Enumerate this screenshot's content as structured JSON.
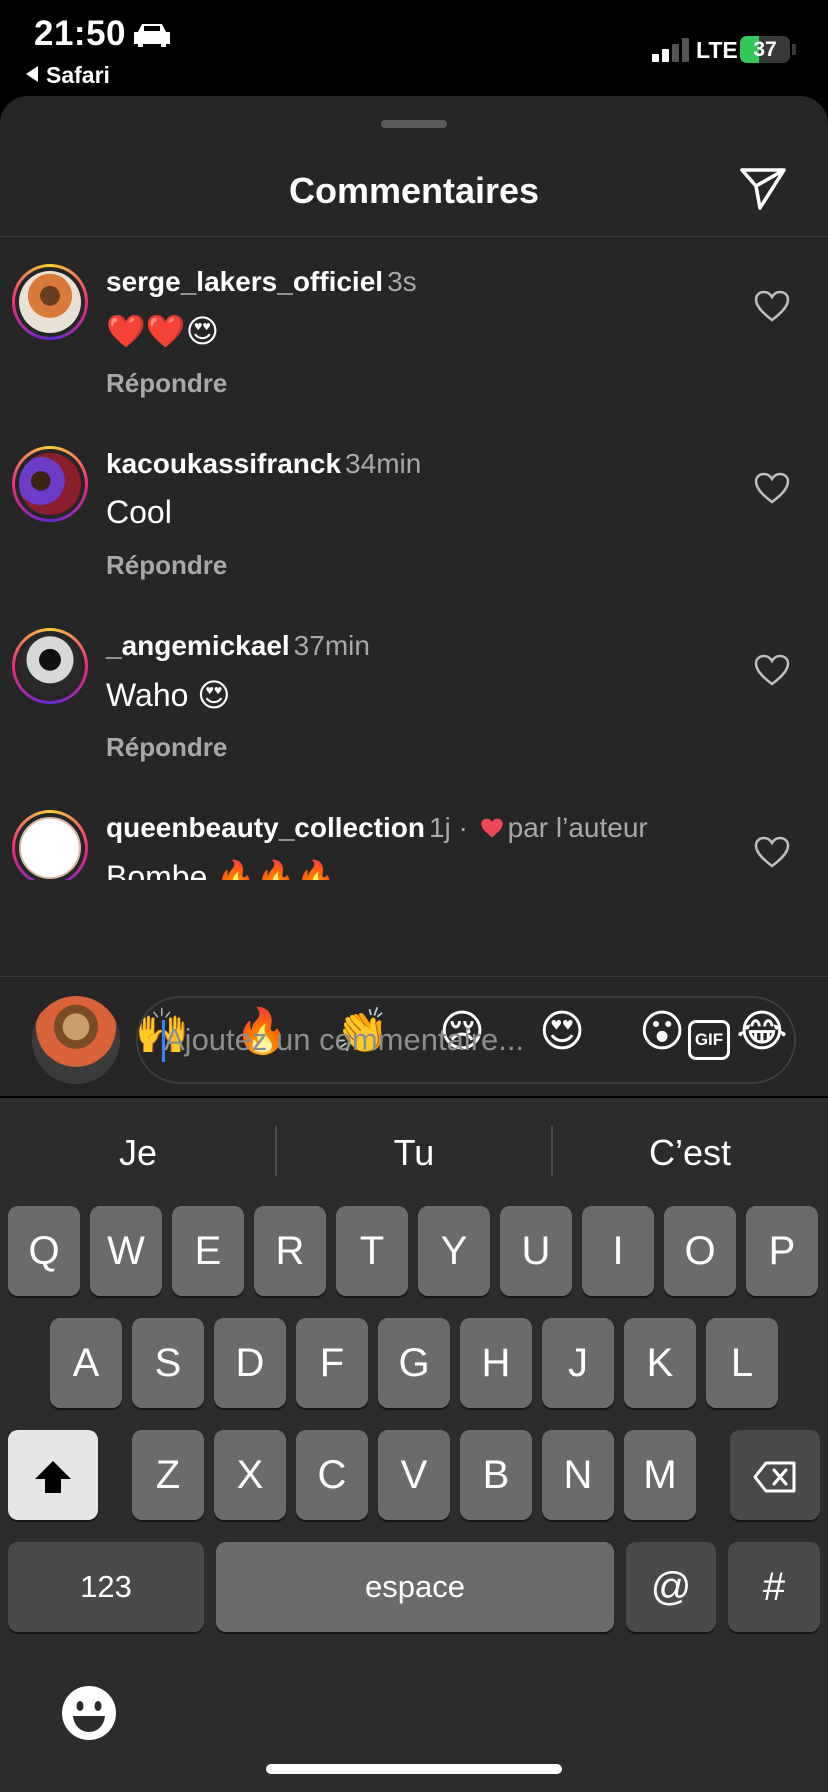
{
  "status": {
    "time": "21:50",
    "back_label": "Safari",
    "network": "LTE",
    "battery": "37"
  },
  "sheet": {
    "title": "Commentaires"
  },
  "comments": [
    {
      "user": "serge_lakers_officiel",
      "time": "3s",
      "text": "❤️❤️😍",
      "reply": "Répondre"
    },
    {
      "user": "kacoukassifranck",
      "time": "34min",
      "text": "Cool",
      "reply": "Répondre"
    },
    {
      "user": "_angemickael",
      "time": "37min",
      "text": "Waho 😍",
      "reply": "Répondre"
    },
    {
      "user": "queenbeauty_collection",
      "time": "1j ·",
      "liked_by_author": "par l’auteur",
      "text": "Bombe 🔥🔥🔥"
    }
  ],
  "quick_emojis": [
    "❤️",
    "🙌",
    "🔥",
    "👏",
    "😢",
    "😍",
    "😮",
    "😂"
  ],
  "composer": {
    "placeholder": "Ajoutez un commentaire...",
    "gif_label": "GIF"
  },
  "keyboard": {
    "suggestions": [
      "Je",
      "Tu",
      "C’est"
    ],
    "row1": [
      "Q",
      "W",
      "E",
      "R",
      "T",
      "Y",
      "U",
      "I",
      "O",
      "P"
    ],
    "row2": [
      "A",
      "S",
      "D",
      "F",
      "G",
      "H",
      "J",
      "K",
      "L"
    ],
    "row3": [
      "Z",
      "X",
      "C",
      "V",
      "B",
      "N",
      "M"
    ],
    "numbers_key": "123",
    "space_key": "espace",
    "at_key": "@",
    "hash_key": "#"
  },
  "colors": {
    "sheet_bg": "#262626",
    "heart_red": "#ed4956",
    "caret_blue": "#3b82f6"
  }
}
